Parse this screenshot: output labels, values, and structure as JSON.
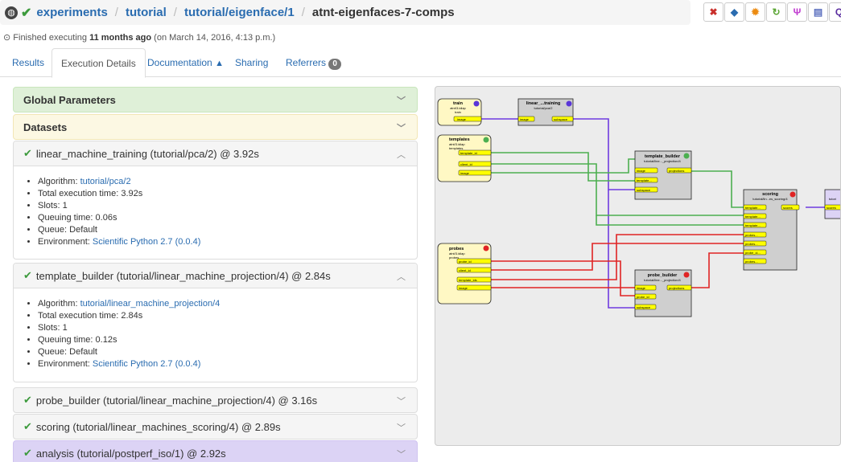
{
  "breadcrumb": {
    "root": "experiments",
    "path1": "tutorial",
    "path2": "tutorial/eigenface/1",
    "current": "atnt-eigenfaces-7-comps"
  },
  "toolbar": {
    "buttons": [
      {
        "icon": "delete-icon",
        "glyph": "✖",
        "color": "#c9302c"
      },
      {
        "icon": "tag-icon",
        "glyph": "◆",
        "color": "#2a6cb0"
      },
      {
        "icon": "attest-icon",
        "glyph": "✹",
        "color": "#ec8b11"
      },
      {
        "icon": "reset-icon",
        "glyph": "↻",
        "color": "#5aa532"
      },
      {
        "icon": "fork-icon",
        "glyph": "Ψ",
        "color": "#c03bd0"
      },
      {
        "icon": "report-icon",
        "glyph": "▤",
        "color": "#5b6fbf"
      },
      {
        "icon": "search-icon",
        "glyph": "Q",
        "color": "#5b2ea0"
      }
    ]
  },
  "status": {
    "prefix": "Finished executing",
    "when": "11 months ago",
    "suffix": "(on March 14, 2016, 4:13 p.m.)"
  },
  "tabs": {
    "results": "Results",
    "execution": "Execution Details",
    "documentation": "Documentation",
    "sharing": "Sharing",
    "referrers": "Referrers",
    "referrers_count": "0"
  },
  "panels": {
    "global": "Global Parameters",
    "datasets": "Datasets",
    "lmt": {
      "title": "linear_machine_training (tutorial/pca/2) @ 3.92s",
      "algo_label": "Algorithm: ",
      "algo": "tutorial/pca/2",
      "total": "Total execution time: 3.92s",
      "slots": "Slots: 1",
      "queuing": "Queuing time: 0.06s",
      "queue": "Queue: Default",
      "env_label": "Environment: ",
      "env": "Scientific Python 2.7 (0.0.4)"
    },
    "tb": {
      "title": "template_builder (tutorial/linear_machine_projection/4) @ 2.84s",
      "algo_label": "Algorithm: ",
      "algo": "tutorial/linear_machine_projection/4",
      "total": "Total execution time: 2.84s",
      "slots": "Slots: 1",
      "queuing": "Queuing time: 0.12s",
      "queue": "Queue: Default",
      "env_label": "Environment: ",
      "env": "Scientific Python 2.7 (0.0.4)"
    },
    "probe": "probe_builder (tutorial/linear_machine_projection/4) @ 3.16s",
    "scoring": "scoring (tutorial/linear_machines_scoring/4) @ 2.89s",
    "analysis": "analysis (tutorial/postperf_iso/1) @ 2.92s"
  },
  "graph": {
    "train": {
      "title": "train",
      "sub1": "atnt/3.idiap",
      "sub2": "train",
      "port": "image"
    },
    "lmt": {
      "title": "linear_...training",
      "sub1": "tutorial/pca/2",
      "in": "image",
      "out": "subspace"
    },
    "templates": {
      "title": "templates",
      "sub1": "atnt/3.idiap",
      "sub2": "templates",
      "ports": [
        "template_id",
        "client_id",
        "image"
      ]
    },
    "tb": {
      "title": "template_builder",
      "sub1": "tutorial/line..._projection/4",
      "ins": [
        "image",
        "template...",
        "subspace"
      ],
      "out": "projections"
    },
    "scoring": {
      "title": "scoring",
      "sub1": "tutorial/lin...es_scoring/4",
      "ins": [
        "template...",
        "template...",
        "template...",
        "probes...",
        "probes...",
        "probe_cl...",
        "probes..."
      ],
      "out": "scores"
    },
    "probes": {
      "title": "probes",
      "sub1": "atnt/3.idiap",
      "sub2": "probes",
      "ports": [
        "probe_id",
        "client_id",
        "template_ids",
        "image"
      ]
    },
    "pb": {
      "title": "probe_builder",
      "sub1": "tutorial/line..._projection/4",
      "ins": [
        "image",
        "probe_id",
        "subspace"
      ],
      "out": "projections"
    },
    "analysis": {
      "title": "tutori",
      "in": "scores"
    }
  }
}
